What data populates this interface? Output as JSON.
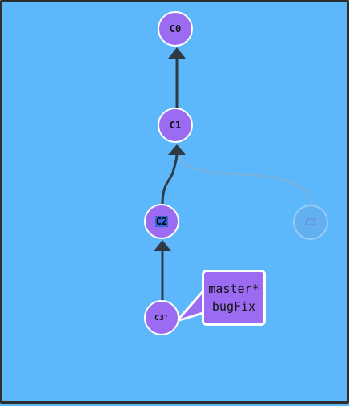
{
  "commits": {
    "c0": {
      "label": "C0"
    },
    "c1": {
      "label": "C1"
    },
    "c2": {
      "label": "C2"
    },
    "c3_ghost": {
      "label": "C3"
    },
    "c3_prime": {
      "label": "C3'"
    }
  },
  "branch_tag": {
    "master": "master*",
    "bugfix": "bugFix"
  },
  "colors": {
    "background": "#5cb8fb",
    "commit_fill": "#9b6bf2",
    "edge": "#2f3a44",
    "highlight": "#3566d6"
  }
}
